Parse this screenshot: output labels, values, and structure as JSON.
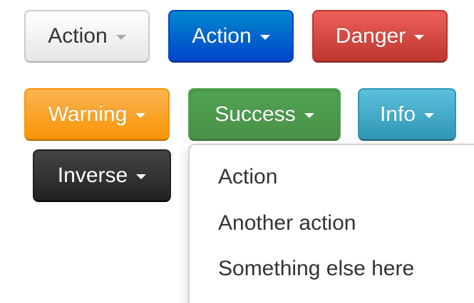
{
  "buttons": [
    {
      "id": "action-default",
      "label": "Action",
      "style": "default"
    },
    {
      "id": "action-primary",
      "label": "Action",
      "style": "primary"
    },
    {
      "id": "danger",
      "label": "Danger",
      "style": "danger"
    },
    {
      "id": "warning",
      "label": "Warning",
      "style": "warning"
    },
    {
      "id": "success",
      "label": "Success",
      "style": "success",
      "open": true
    },
    {
      "id": "info",
      "label": "Info",
      "style": "info"
    },
    {
      "id": "inverse",
      "label": "Inverse",
      "style": "inverse"
    }
  ],
  "dropdown": {
    "items": [
      {
        "label": "Action"
      },
      {
        "label": "Another action"
      },
      {
        "label": "Something else here"
      }
    ]
  },
  "colors": {
    "default": "#e6e6e6",
    "primary": "#0044cc",
    "danger": "#bd362f",
    "warning": "#f89406",
    "success": "#51a351",
    "info": "#2f96b4",
    "inverse": "#222222"
  }
}
